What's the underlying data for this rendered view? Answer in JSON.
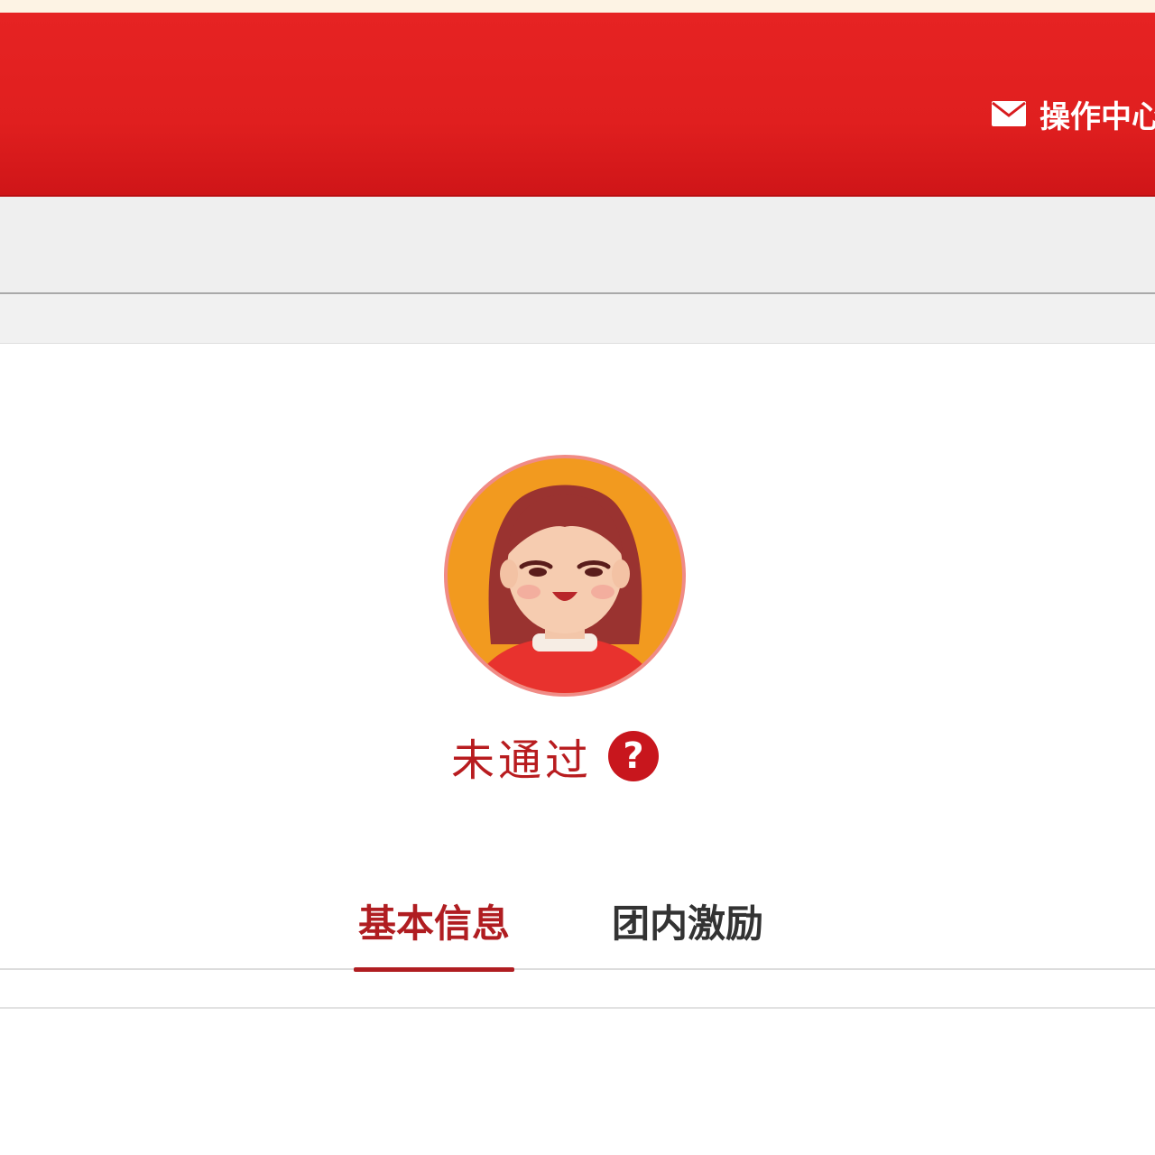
{
  "header": {
    "ops_center_label": "操作中心",
    "mail_icon": "envelope-icon",
    "brand_color": "#e01f1f"
  },
  "profile": {
    "avatar_icon": "female-avatar-icon",
    "status_text": "未通过",
    "help_icon": "question-mark-icon",
    "status_color": "#b81c1f"
  },
  "tabs": [
    {
      "label": "基本信息",
      "active": true
    },
    {
      "label": "团内激励",
      "active": false
    }
  ]
}
